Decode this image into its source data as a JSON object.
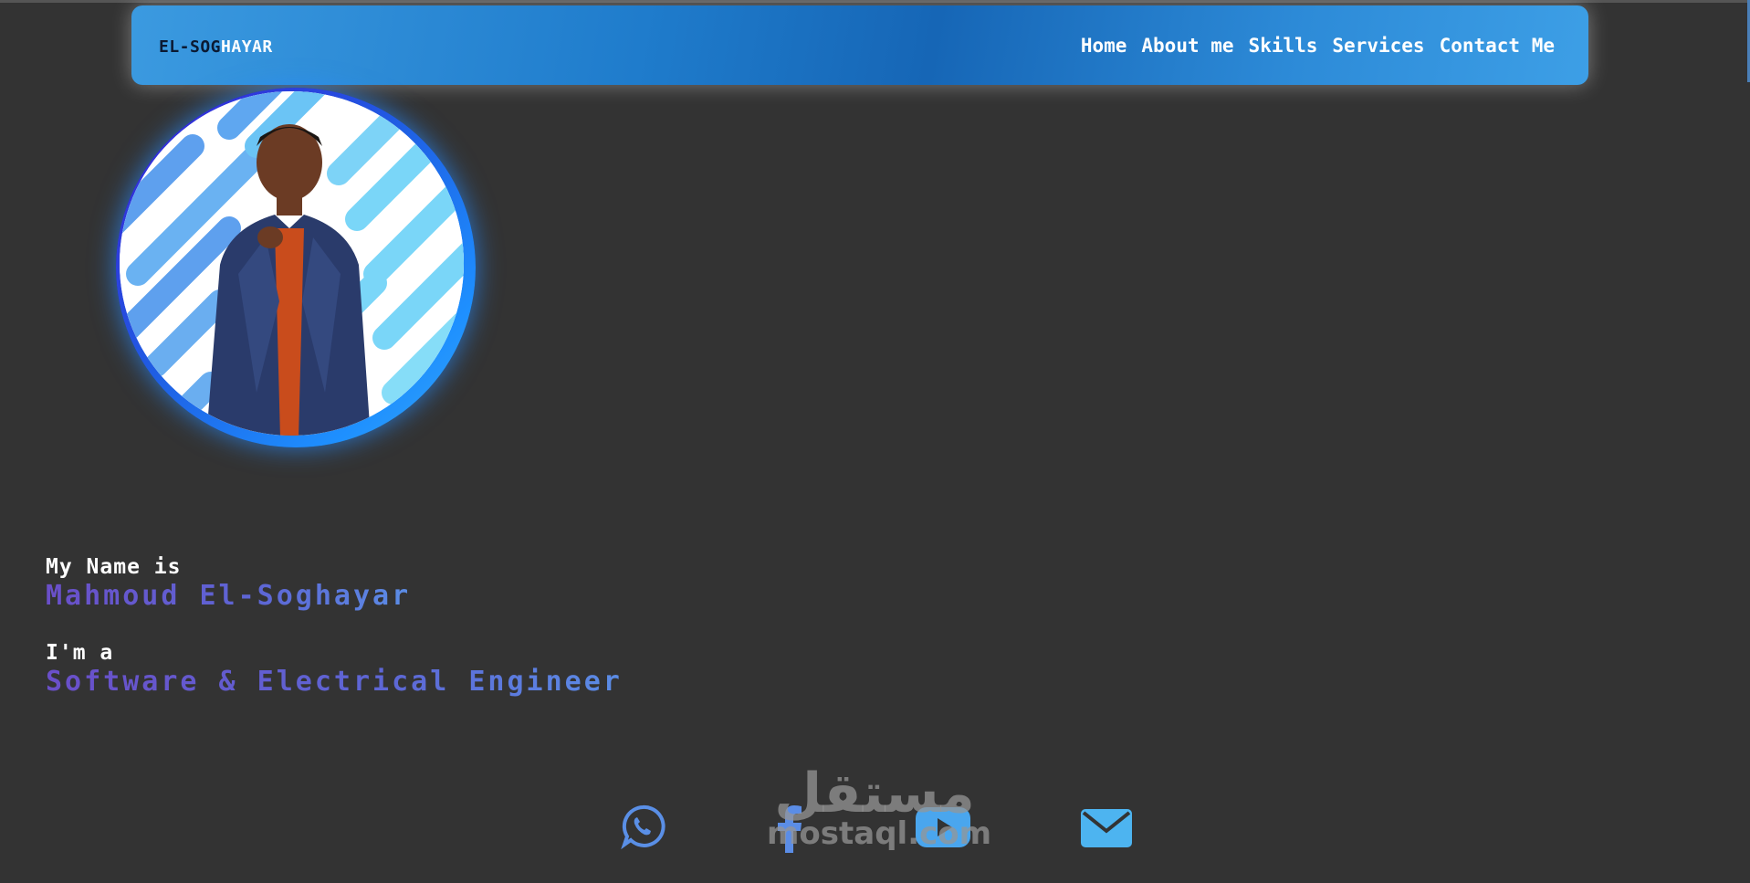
{
  "header": {
    "logo_dark": "EL-SOG",
    "logo_light": "HAYAR",
    "nav": [
      "Home",
      "About me",
      "Skills",
      "Services",
      "Contact Me"
    ]
  },
  "profile": {
    "photo": "person-portrait",
    "ring_colors": [
      "#3a1bd6",
      "#1e90ff"
    ]
  },
  "intro": {
    "name_label": "My Name is",
    "name": "Mahmoud El-Soghayar",
    "role_label": "I'm a",
    "role": "Software & Electrical Engineer"
  },
  "socials": [
    {
      "icon": "whatsapp-icon",
      "color": "#5a8fe6"
    },
    {
      "icon": "facebook-icon",
      "color": "#5b8de6"
    },
    {
      "icon": "youtube-icon",
      "color": "#4aa6ee"
    },
    {
      "icon": "email-icon",
      "color": "#4db4f0"
    }
  ],
  "watermark": {
    "arabic": "مستقل",
    "latin": "mostaql.com"
  },
  "colors": {
    "background": "#333333",
    "nav_gradient_start": "#3b9ae0",
    "nav_gradient_mid": "#1666b6",
    "accent_purple": "#6a4fc9",
    "accent_blue": "#5b8de6"
  }
}
